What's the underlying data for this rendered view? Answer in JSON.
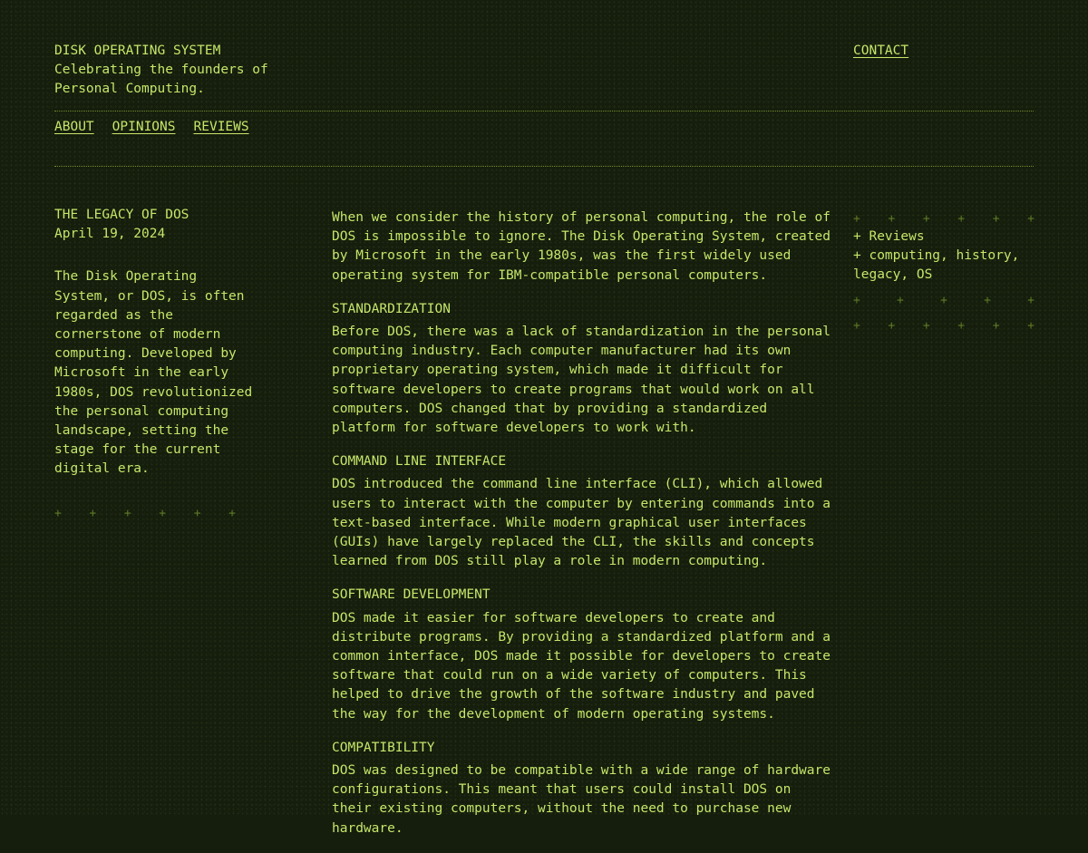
{
  "header": {
    "title": "DISK OPERATING SYSTEM",
    "tagline": "Celebrating the founders of Personal Computing.",
    "contact_label": "CONTACT"
  },
  "nav": {
    "items": [
      {
        "label": "ABOUT"
      },
      {
        "label": "OPINIONS"
      },
      {
        "label": "REVIEWS"
      }
    ]
  },
  "post": {
    "title": "THE LEGACY OF DOS",
    "date": "April 19, 2024",
    "summary": "The Disk Operating System, or DOS, is often regarded as the cornerstone of modern computing. Developed by Microsoft in the early 1980s, DOS revolutionized the personal computing landscape, setting the stage for the current digital era.",
    "intro": "When we consider the history of personal computing, the role of DOS is impossible to ignore. The Disk Operating System, created by Microsoft in the early 1980s, was the first widely used operating system for IBM-compatible personal computers.",
    "sections": [
      {
        "heading": "STANDARDIZATION",
        "body": "Before DOS, there was a lack of standardization in the personal computing industry. Each computer manufacturer had its own proprietary operating system, which made it difficult for software developers to create programs that would work on all computers. DOS changed that by providing a standardized platform for software developers to work with."
      },
      {
        "heading": "COMMAND LINE INTERFACE",
        "body": "DOS introduced the command line interface (CLI), which allowed users to interact with the computer by entering commands into a text-based interface. While modern graphical user interfaces (GUIs) have largely replaced the CLI, the skills and concepts learned from DOS still play a role in modern computing."
      },
      {
        "heading": "SOFTWARE DEVELOPMENT",
        "body": "DOS made it easier for software developers to create and distribute programs. By providing a standardized platform and a common interface, DOS made it possible for developers to create software that could run on a wide variety of computers. This helped to drive the growth of the software industry and paved the way for the development of modern operating systems."
      },
      {
        "heading": "COMPATIBILITY",
        "body": "DOS was designed to be compatible with a wide range of hardware configurations. This meant that users could install DOS on their existing computers, without the need to purchase new hardware."
      }
    ]
  },
  "meta": {
    "category": "+ Reviews",
    "tags": "+ computing, history, legacy, OS"
  },
  "decor": {
    "plus_symbol": "+"
  },
  "colors": {
    "background": "#151d0c",
    "text": "#c6e66a",
    "rule": "#6f8a2e"
  }
}
